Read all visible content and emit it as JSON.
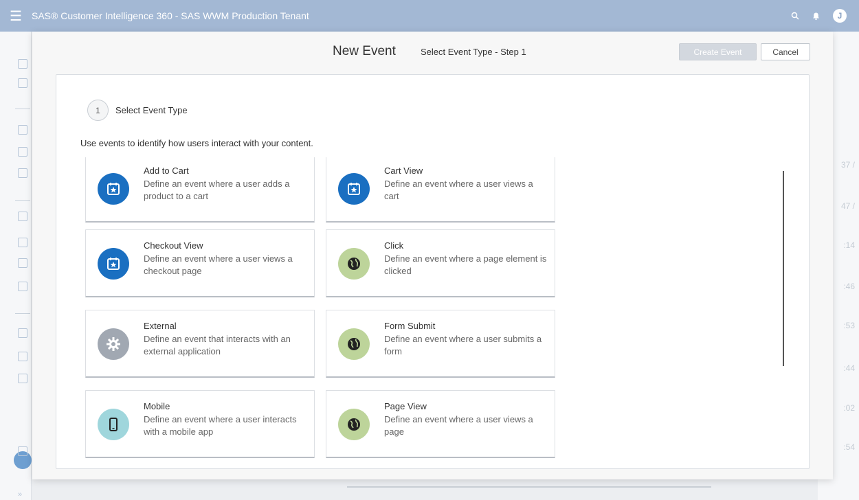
{
  "app": {
    "title": "SAS® Customer Intelligence 360 - SAS WWM Production Tenant",
    "avatar_initial": "J"
  },
  "background": {
    "times": [
      "37 /",
      "47 /",
      ":14",
      ":46",
      ":53",
      ":44",
      ":02",
      ":54"
    ]
  },
  "modal": {
    "title": "New Event",
    "step_title": "Select Event Type - Step 1",
    "create_button": "Create Event",
    "cancel_button": "Cancel",
    "step_number": "1",
    "step_label": "Select Event Type",
    "description": "Use events to identify how users interact with your content.",
    "event_types": [
      {
        "title": "Add to Cart",
        "description": "Define an event where a user adds a product to a cart",
        "icon": "calendar-star-icon",
        "color": "#1a6fc1"
      },
      {
        "title": "Cart View",
        "description": "Define an event where a user views a cart",
        "icon": "calendar-star-icon",
        "color": "#1a6fc1"
      },
      {
        "title": "Checkout View",
        "description": "Define an event where a user views a checkout page",
        "icon": "calendar-star-icon",
        "color": "#1a6fc1"
      },
      {
        "title": "Click",
        "description": "Define an event where a page element is clicked",
        "icon": "globe-icon",
        "color": "#bdd49a"
      },
      {
        "title": "External",
        "description": "Define an event that interacts with an external application",
        "icon": "gear-icon",
        "color": "#a1a8b2"
      },
      {
        "title": "Form Submit",
        "description": "Define an event where a user submits a form",
        "icon": "globe-icon",
        "color": "#bdd49a"
      },
      {
        "title": "Mobile",
        "description": "Define an event where a user interacts with a mobile app",
        "icon": "mobile-phone-icon",
        "color": "#9fd6dc"
      },
      {
        "title": "Page View",
        "description": "Define an event where a user views a page",
        "icon": "globe-icon",
        "color": "#bdd49a"
      }
    ]
  }
}
